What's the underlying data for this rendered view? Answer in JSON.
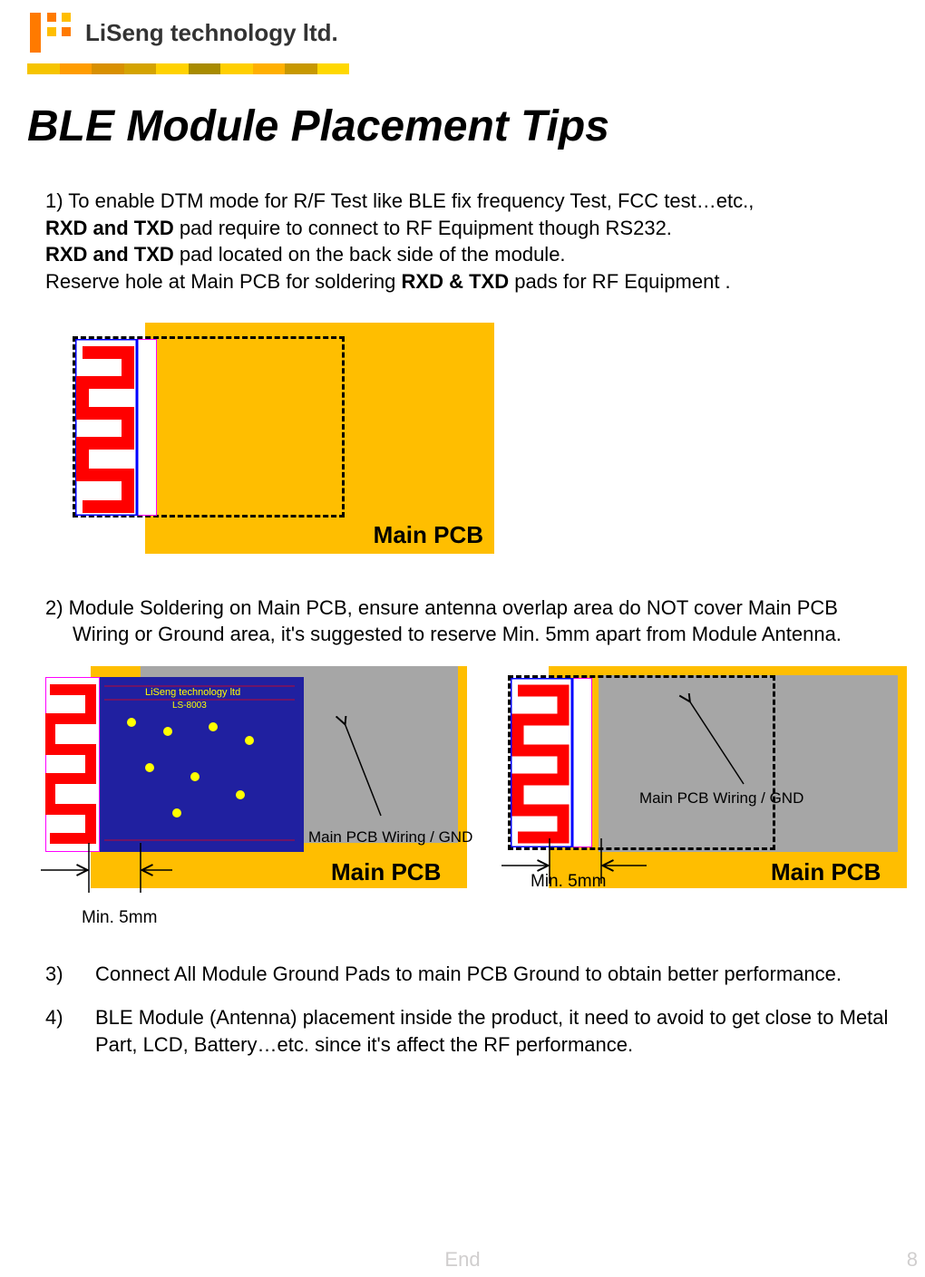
{
  "header": {
    "company": "LiSeng technology ltd."
  },
  "title": "BLE Module Placement Tips",
  "tip1": {
    "line1_pre": "1)     To enable DTM mode for R/F Test like BLE fix frequency Test, FCC test…etc.,",
    "line2_bold": "RXD and TXD",
    "line2_rest": " pad require to connect to RF Equipment though RS232.",
    "line3_bold": "RXD and TXD",
    "line3_rest": " pad located on the back side of the module.",
    "line4_pre": "Reserve hole at  Main PCB  for soldering ",
    "line4_bold": "RXD & TXD",
    "line4_rest": " pads for RF Equipment ."
  },
  "diagram_labels": {
    "main_pcb": "Main PCB",
    "wiring_gnd": "Main PCB Wiring / GND",
    "min5mm": "Min. 5mm"
  },
  "tip2": {
    "text": "2)   Module Soldering on Main PCB, ensure antenna overlap area do NOT cover Main PCB Wiring or Ground area, it's suggested to reserve Min. 5mm apart from Module Antenna."
  },
  "tip3": {
    "num": "3)",
    "text": "Connect All Module Ground Pads to main PCB Ground  to obtain better performance."
  },
  "tip4": {
    "num": "4)",
    "text": "BLE Module (Antenna) placement inside the product, it need to avoid to get close to Metal Part, LCD, Battery…etc. since it's affect the RF performance."
  },
  "footer": {
    "end": "End",
    "page": "8"
  }
}
